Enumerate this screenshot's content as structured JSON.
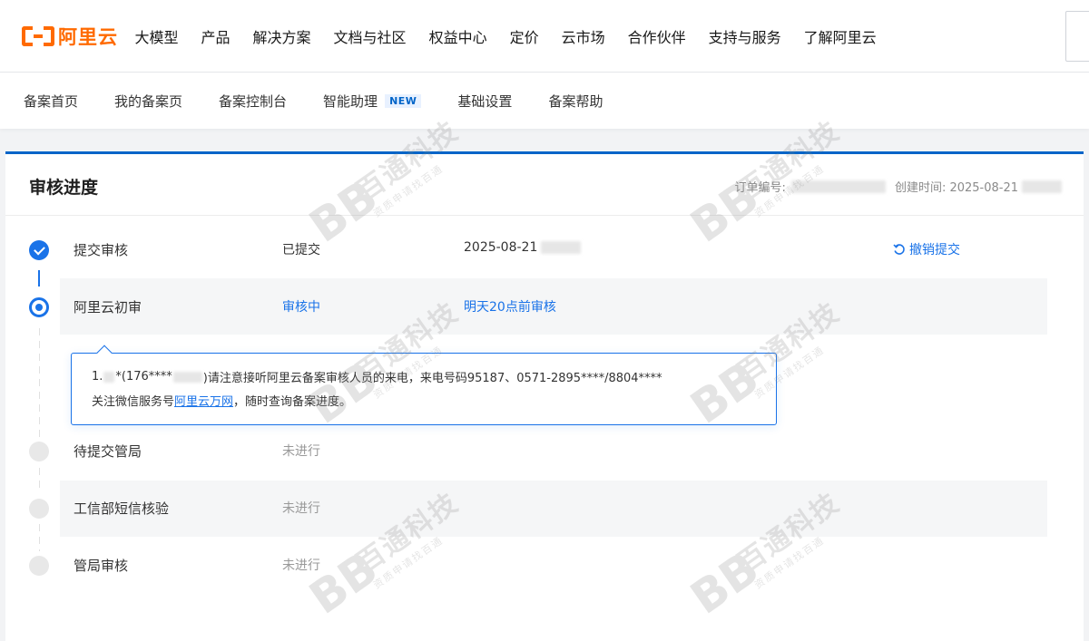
{
  "brand": {
    "logo_text": "阿里云"
  },
  "topnav": {
    "items": [
      "大模型",
      "产品",
      "解决方案",
      "文档与社区",
      "权益中心",
      "定价",
      "云市场",
      "合作伙伴",
      "支持与服务",
      "了解阿里云"
    ]
  },
  "subnav": {
    "items": [
      "备案首页",
      "我的备案页",
      "备案控制台",
      "智能助理",
      "基础设置",
      "备案帮助"
    ],
    "new_badge": "NEW"
  },
  "card": {
    "title": "审核进度",
    "order_label": "订单编号:",
    "created_label": "创建时间: 2025-08-21"
  },
  "steps": [
    {
      "name": "提交审核",
      "status": "已提交",
      "time": "2025-08-21",
      "state": "done"
    },
    {
      "name": "阿里云初审",
      "status": "审核中",
      "time": "明天20点前审核",
      "state": "current"
    },
    {
      "name": "待提交管局",
      "status": "未进行",
      "time": "",
      "state": "pending"
    },
    {
      "name": "工信部短信核验",
      "status": "未进行",
      "time": "",
      "state": "pending"
    },
    {
      "name": "管局审核",
      "status": "未进行",
      "time": "",
      "state": "pending"
    }
  ],
  "cancel_label": "撤销提交",
  "notice": {
    "line1_prefix": "1.",
    "line1_mid": "*(176****",
    "line1_rest": ")请注意接听阿里云备案审核人员的来电，来电号码95187、0571-2895****/8804****",
    "line2_prefix": "关注微信服务号",
    "line2_link": "阿里云万网",
    "line2_suffix": "，随时查询备案进度。"
  },
  "watermark": {
    "logo": "BB",
    "main": "百通科技",
    "sub": "资质申请找百通"
  },
  "colors": {
    "brand": "#ff6a00",
    "accent": "#1a73e8",
    "card_top": "#0064c8"
  }
}
